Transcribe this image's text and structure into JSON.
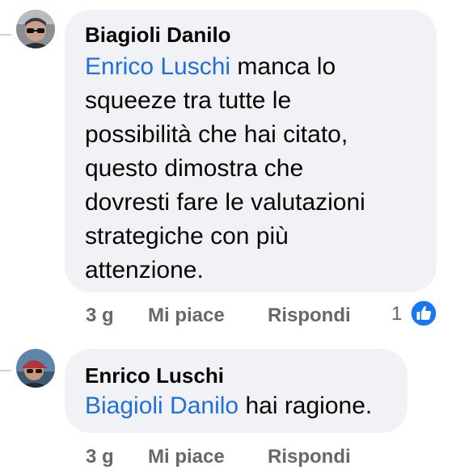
{
  "colors": {
    "bubble": "#f0f2f5",
    "mention": "#216fdb",
    "text": "#050505",
    "meta": "#65676b",
    "like_blue": "#1877f2"
  },
  "comments": [
    {
      "author": "Biagioli Danilo",
      "mention": "Enrico Luschi",
      "lines": [
        " manca lo",
        "squeeze tra tutte le",
        "possibilità che hai citato,",
        "questo dimostra che",
        "dovresti fare le valutazioni",
        "strategiche con più",
        "attenzione."
      ],
      "time": "3 g",
      "like_label": "Mi piace",
      "reply_label": "Rispondi",
      "reaction_count": "1",
      "reaction_icon": "thumbs-up-icon"
    },
    {
      "author": "Enrico Luschi",
      "mention": "Biagioli Danilo",
      "text": " hai ragione.",
      "time": "3 g",
      "like_label": "Mi piace",
      "reply_label": "Rispondi"
    }
  ]
}
